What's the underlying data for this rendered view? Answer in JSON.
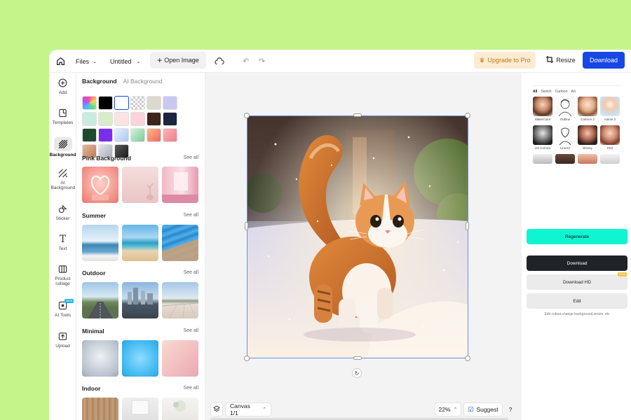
{
  "topbar": {
    "home_icon": "home-icon",
    "files_label": "Files",
    "doc_title": "Untitled",
    "open_image_label": "Open Image",
    "upgrade_label": "Upgrade to Pro",
    "resize_label": "Resize",
    "download_label": "Download"
  },
  "leftnav": {
    "items": [
      {
        "label": "Add",
        "icon": "plus-circle-icon"
      },
      {
        "label": "Templates",
        "icon": "templates-icon"
      },
      {
        "label": "Background",
        "icon": "background-icon"
      },
      {
        "label": "AI Background",
        "icon": "ai-background-icon"
      },
      {
        "label": "Sticker",
        "icon": "sticker-icon"
      },
      {
        "label": "Text",
        "icon": "text-icon"
      },
      {
        "label": "Product collage",
        "icon": "collage-icon"
      },
      {
        "label": "AI Tools",
        "icon": "ai-tools-icon",
        "badge": "NEW"
      },
      {
        "label": "Upload",
        "icon": "upload-icon"
      }
    ]
  },
  "panel": {
    "tab_background": "Background",
    "tab_ai_background": "AI Background",
    "swatch_colors": [
      "#ff7ad9",
      "#000000",
      "#ffffff",
      "transparent",
      "#ddd8d0",
      "#c8c8f0",
      "#c8ede0",
      "#d9ecc8",
      "#fde3e0",
      "#fbd3d8",
      "#3b2418",
      "#1c2440",
      "#1d4a2c",
      "#7a2cf0",
      "#c9dcf5",
      "#a6dbb8",
      "#f69a92",
      "#f59aa0",
      "#d69a7c",
      "#c6cbd2",
      "#3a3a3a"
    ],
    "sections": [
      {
        "title": "Pink Background",
        "see_all": "See all"
      },
      {
        "title": "Summer",
        "see_all": "See all"
      },
      {
        "title": "Outdoor",
        "see_all": "See all"
      },
      {
        "title": "Minimal",
        "see_all": "See all"
      },
      {
        "title": "Indoor",
        "see_all": "See all"
      }
    ]
  },
  "canvas": {
    "canvas_label": "Canvas 1/1",
    "zoom": "22%",
    "suggest_label": "Suggest",
    "help_label": "?"
  },
  "right": {
    "style_tabs": [
      "All",
      "Sketch",
      "Cartoon",
      "Art"
    ],
    "styles": [
      "WaterColor",
      "Outline",
      "Cartoon 2",
      "Anime 2",
      "US Comics",
      "LineArt",
      "Disney",
      "PS2",
      "",
      "",
      "",
      ""
    ],
    "regenerate_label": "Regenerate",
    "download_label": "Download",
    "download_hd_label": "Download HD",
    "pro_badge": "PRO",
    "edit_label": "Edit",
    "hint": "Edit cutout,change background,resize, etc"
  }
}
